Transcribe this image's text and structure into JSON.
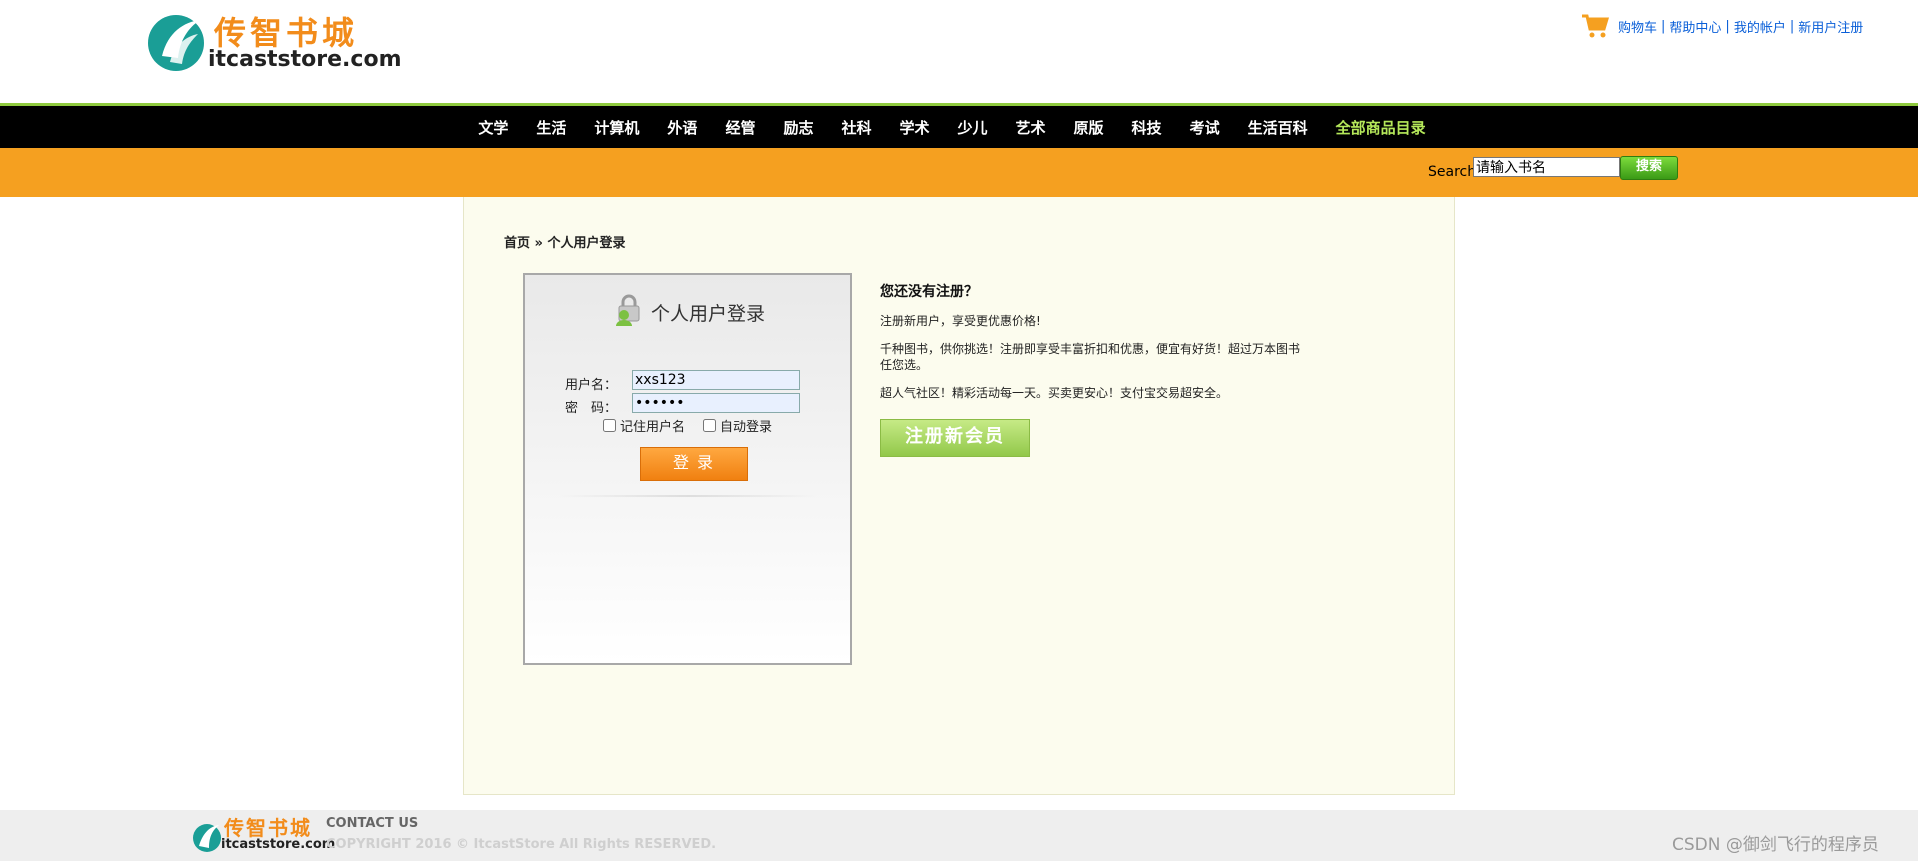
{
  "header": {
    "logo_cn": "传智书城",
    "logo_en": "itcaststore.com",
    "links": [
      "购物车",
      "帮助中心",
      "我的帐户",
      "新用户注册"
    ],
    "separator": "|"
  },
  "nav": {
    "items": [
      "文学",
      "生活",
      "计算机",
      "外语",
      "经管",
      "励志",
      "社科",
      "学术",
      "少儿",
      "艺术",
      "原版",
      "科技",
      "考试",
      "生活百科"
    ],
    "all_items": "全部商品目录"
  },
  "search": {
    "label": "Search",
    "value": "请输入书名",
    "button": "搜索"
  },
  "breadcrumb": {
    "home": "首页",
    "sep": "»",
    "current": "个人用户登录"
  },
  "login": {
    "title": "个人用户登录",
    "username_label": "用户名：",
    "password_label": "密　码：",
    "username_value": "xxs123",
    "password_value": "••••••",
    "remember_username": "记住用户名",
    "auto_login": "自动登录",
    "button": "登录"
  },
  "register": {
    "title": "您还没有注册？",
    "p1": "注册新用户，享受更优惠价格!",
    "p2": "千种图书，供你挑选！注册即享受丰富折扣和优惠，便宜有好货！超过万本图书任您选。",
    "p3": "超人气社区！精彩活动每一天。买卖更安心！支付宝交易超安全。",
    "button": "注册新会员"
  },
  "footer": {
    "logo_cn": "传智书城",
    "logo_en": "itcaststore.com",
    "contact": "CONTACT US",
    "copyright": "COPYRIGHT 2016 © ItcastStore All Rights RESERVED.",
    "watermark": "CSDN @御剑飞行的程序员"
  },
  "colors": {
    "brand_orange": "#f5a020",
    "nav_bg": "#000000",
    "accent_green": "#8fca3e",
    "link_blue": "#0a5fd8"
  }
}
